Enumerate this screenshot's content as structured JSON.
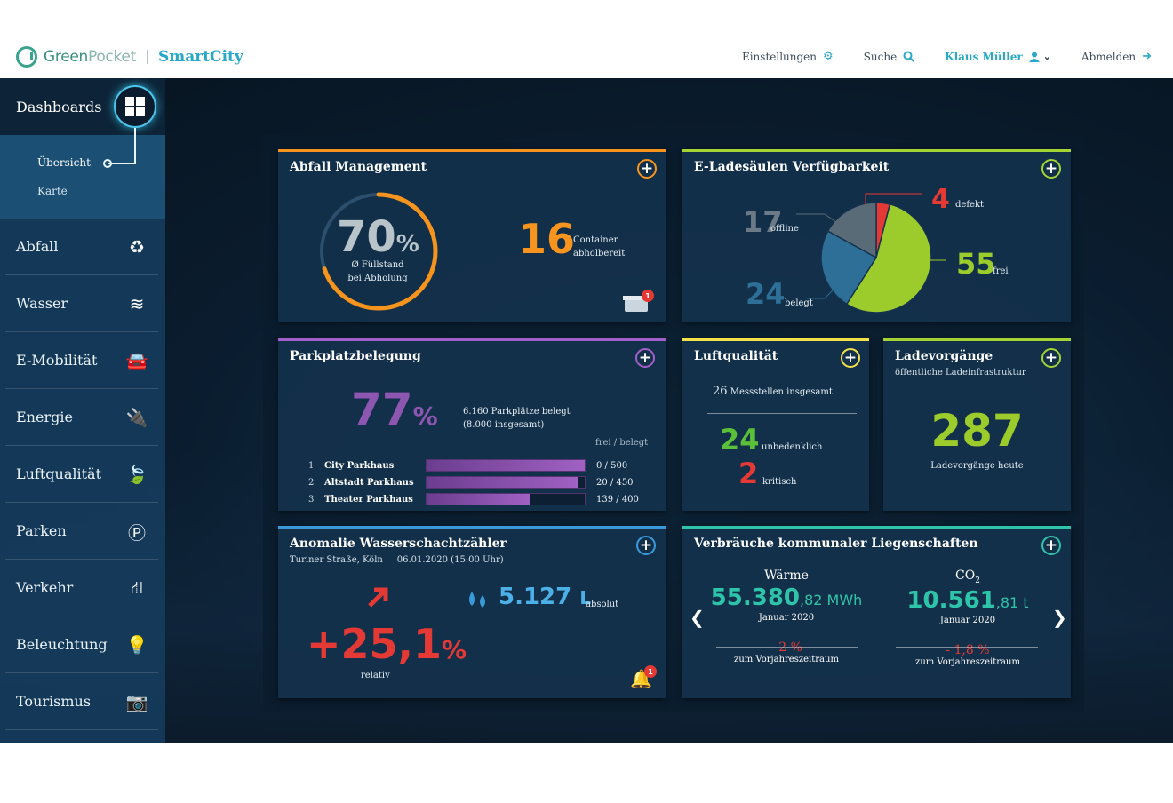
{
  "header": {
    "logo_brand_a": "Green",
    "logo_brand_b": "Pocket",
    "logo_product": "SmartCity",
    "nav": {
      "settings": "Einstellungen",
      "search": "Suche",
      "user": "Klaus Müller",
      "logout": "Abmelden"
    }
  },
  "sidebar": {
    "dashboards": "Dashboards",
    "sub_items": [
      "Übersicht",
      "Karte"
    ],
    "items": [
      {
        "label": "Abfall",
        "icon": "recycle-icon"
      },
      {
        "label": "Wasser",
        "icon": "water-waves-icon"
      },
      {
        "label": "E-Mobilität",
        "icon": "car-icon"
      },
      {
        "label": "Energie",
        "icon": "plug-icon"
      },
      {
        "label": "Luftqualität",
        "icon": "leaf-icon"
      },
      {
        "label": "Parken",
        "icon": "parking-icon"
      },
      {
        "label": "Verkehr",
        "icon": "road-icon"
      },
      {
        "label": "Beleuchtung",
        "icon": "lightbulb-icon"
      },
      {
        "label": "Tourismus",
        "icon": "camera-icon"
      }
    ]
  },
  "cards": {
    "abfall": {
      "title": "Abfall Management",
      "percent": "70",
      "percent_sign": "%",
      "fill_fraction": 0.7,
      "percent_label_1": "Ø Füllstand",
      "percent_label_2": "bei Abholung",
      "containers": "16",
      "containers_label_1": "Container",
      "containers_label_2": "abholbereit",
      "alert_count": "1",
      "accent": "#f7941d"
    },
    "ladesaeulen": {
      "title": "E-Ladesäulen Verfügbarkeit",
      "accent": "#a4d334",
      "chart_data": {
        "type": "pie",
        "slices": [
          {
            "label": "defekt",
            "value": 4,
            "color": "#e53935"
          },
          {
            "label": "frei",
            "value": 55,
            "color": "#9ccb2c"
          },
          {
            "label": "belegt",
            "value": 24,
            "color": "#2e6f97"
          },
          {
            "label": "offline",
            "value": 17,
            "color": "#5a6b78"
          }
        ]
      },
      "defekt": "4",
      "defekt_label": "defekt",
      "frei": "55",
      "frei_label": "frei",
      "belegt": "24",
      "belegt_label": "belegt",
      "offline": "17",
      "offline_label": "offline"
    },
    "parken": {
      "title": "Parkplatzbelegung",
      "accent": "#a35fc9",
      "percent": "77",
      "percent_sign": "%",
      "summary_1": "6.160 Parkplätze belegt",
      "summary_2": "(8.000 insgesamt)",
      "col_header": "frei / belegt",
      "rows": [
        {
          "rank": "1",
          "name": "City Parkhaus",
          "value": "0   / 500",
          "occupied_fraction": 1.0
        },
        {
          "rank": "2",
          "name": "Altstadt Parkhaus",
          "value": "20   / 450",
          "occupied_fraction": 0.9556
        },
        {
          "rank": "3",
          "name": "Theater Parkhaus",
          "value": "139 / 400",
          "occupied_fraction": 0.6525
        }
      ]
    },
    "luft": {
      "title": "Luftqualität",
      "accent": "#f4e14a",
      "total": "26",
      "total_label": "Messstellen insgesamt",
      "ok": "24",
      "ok_label": "unbedenklich",
      "crit": "2",
      "crit_label": "kritisch"
    },
    "lade": {
      "title": "Ladevorgänge",
      "subtitle": "öffentliche Ladeinfrastruktur",
      "accent": "#a4d334",
      "value": "287",
      "label": "Ladevorgänge heute"
    },
    "wasser": {
      "title": "Anomalie Wasserschachtzähler",
      "location": "Turiner Straße, Köln",
      "datetime": "06.01.2020 (15:00 Uhr)",
      "accent": "#3a9ad9",
      "absolute": "5.127",
      "absolute_unit": "L",
      "absolute_label": "absolut",
      "relative": "+25,1",
      "relative_sign": "%",
      "relative_label": "relativ",
      "alert_count": "1"
    },
    "verbrauch": {
      "title": "Verbräuche kommunaler Liegenschaften",
      "accent": "#2ec4a9",
      "left": {
        "heading": "Wärme",
        "value_main": "55.380",
        "value_decimal": ",82 MWh",
        "period": "Januar 2020",
        "change": "- 2 %",
        "change_label": "zum Vorjahreszeitraum"
      },
      "right": {
        "heading": "CO",
        "heading_sub": "2",
        "value_main": "10.561",
        "value_decimal": ",81 t",
        "period": "Januar 2020",
        "change": "- 1,8 %",
        "change_label": "zum Vorjahreszeitraum"
      }
    }
  }
}
